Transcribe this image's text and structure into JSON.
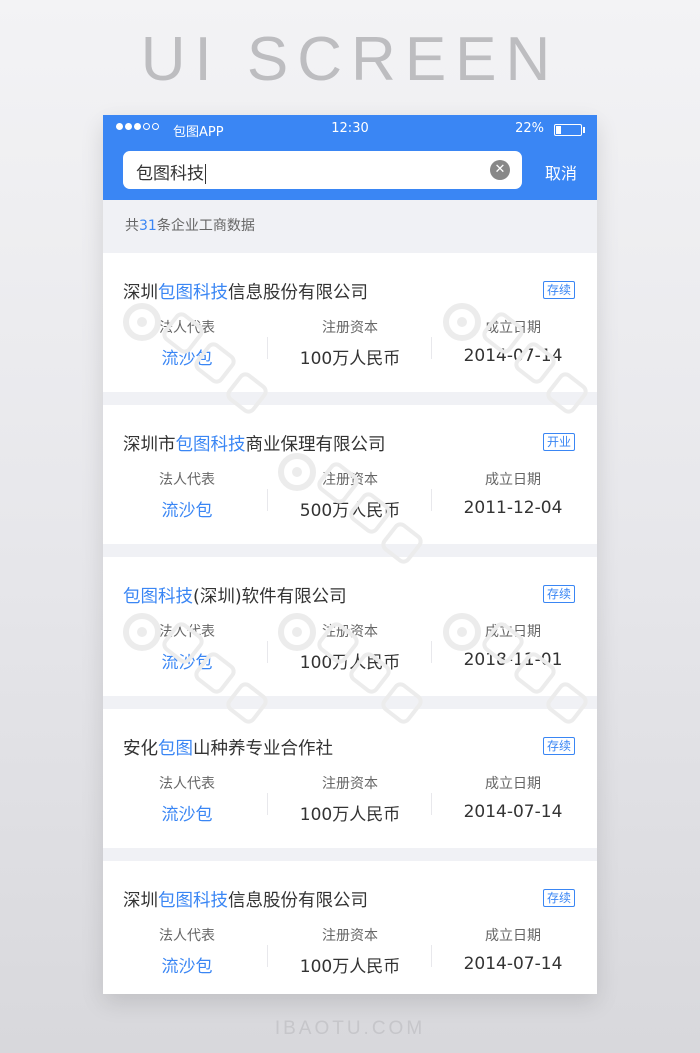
{
  "banner": {
    "title": "UI SCREEN",
    "footer": "IBAOTU.COM"
  },
  "status_bar": {
    "carrier": "包图APP",
    "time": "12:30",
    "battery": "22%",
    "battery_level": 0.22,
    "signal_bars": 3
  },
  "search": {
    "value": "包图科技",
    "clear_icon": "clear-icon",
    "cancel_label": "取消"
  },
  "summary": {
    "prefix": "共",
    "count": "31",
    "suffix": "条企业工商数据"
  },
  "labels": {
    "legal_rep": "法人代表",
    "capital": "注册资本",
    "founded": "成立日期"
  },
  "results": [
    {
      "title_pre": "深圳",
      "title_hl": "包图科技",
      "title_post": "信息股份有限公司",
      "status": "存续",
      "legal_rep": "流沙包",
      "capital": "100万人民币",
      "founded": "2014-07-14"
    },
    {
      "title_pre": "深圳市",
      "title_hl": "包图科技",
      "title_post": "商业保理有限公司",
      "status": "开业",
      "legal_rep": "流沙包",
      "capital": "500万人民币",
      "founded": "2011-12-04"
    },
    {
      "title_pre": "",
      "title_hl": "包图科技",
      "title_post": "(深圳)软件有限公司",
      "status": "存续",
      "legal_rep": "流沙包",
      "capital": "100万人民币",
      "founded": "2018-11-01"
    },
    {
      "title_pre": "安化",
      "title_hl": "包图",
      "title_post": "山种养专业合作社",
      "status": "存续",
      "legal_rep": "流沙包",
      "capital": "100万人民币",
      "founded": "2014-07-14"
    },
    {
      "title_pre": "深圳",
      "title_hl": "包图科技",
      "title_post": "信息股份有限公司",
      "status": "存续",
      "legal_rep": "流沙包",
      "capital": "100万人民币",
      "founded": "2014-07-14"
    }
  ],
  "colors": {
    "accent": "#3a86f4",
    "background": "#f0f1f5"
  }
}
